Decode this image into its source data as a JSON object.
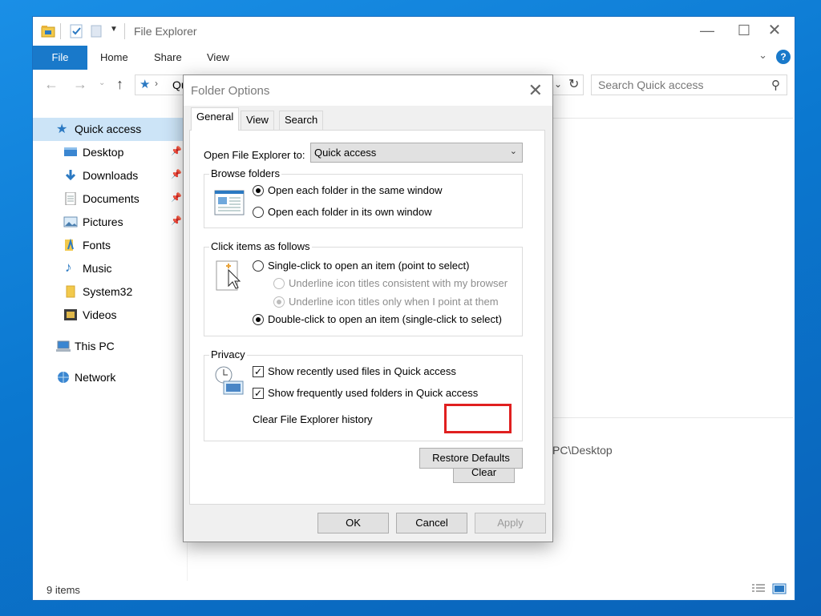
{
  "explorer": {
    "title": "File Explorer",
    "ribbon_tabs": [
      "File",
      "Home",
      "Share",
      "View"
    ],
    "help": "?",
    "address_text": "Qu",
    "search_placeholder": "Search Quick access",
    "nav": [
      {
        "label": "Quick access",
        "icon": "star-icon",
        "pinned": false
      },
      {
        "label": "Desktop",
        "icon": "desktop-icon",
        "pinned": true
      },
      {
        "label": "Downloads",
        "icon": "download-icon",
        "pinned": true
      },
      {
        "label": "Documents",
        "icon": "documents-icon",
        "pinned": true
      },
      {
        "label": "Pictures",
        "icon": "pictures-icon",
        "pinned": true
      },
      {
        "label": "Fonts",
        "icon": "fonts-folder-icon",
        "pinned": false
      },
      {
        "label": "Music",
        "icon": "music-icon",
        "pinned": false
      },
      {
        "label": "System32",
        "icon": "folder-icon",
        "pinned": false
      },
      {
        "label": "Videos",
        "icon": "videos-icon",
        "pinned": false
      },
      {
        "label": "This PC",
        "icon": "computer-icon",
        "pinned": false
      },
      {
        "label": "Network",
        "icon": "network-icon",
        "pinned": false
      }
    ],
    "content_path_fragment": "PC\\Desktop",
    "status": "9 items"
  },
  "dialog": {
    "title": "Folder Options",
    "tabs": [
      "General",
      "View",
      "Search"
    ],
    "open_label": "Open File Explorer to:",
    "open_value": "Quick access",
    "browse": {
      "title": "Browse folders",
      "options": [
        "Open each folder in the same window",
        "Open each folder in its own window"
      ]
    },
    "click": {
      "title": "Click items as follows",
      "single": "Single-click to open an item (point to select)",
      "underline_browser": "Underline icon titles consistent with my browser",
      "underline_point": "Underline icon titles only when I point at them",
      "double": "Double-click to open an item (single-click to select)"
    },
    "privacy": {
      "title": "Privacy",
      "recent_files": "Show recently used files in Quick access",
      "frequent_folders": "Show frequently used folders in Quick access",
      "clear_label": "Clear File Explorer history",
      "clear_button": "Clear"
    },
    "restore_button": "Restore Defaults",
    "ok_button": "OK",
    "cancel_button": "Cancel",
    "apply_button": "Apply"
  },
  "colors": {
    "accent": "#1979ca",
    "highlight": "#e02020",
    "selection": "#cce4f7"
  }
}
